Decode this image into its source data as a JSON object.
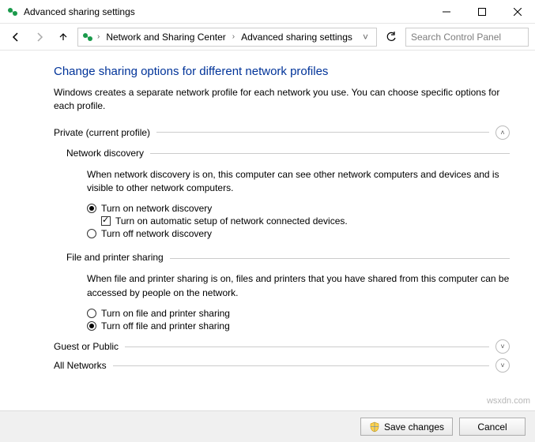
{
  "window": {
    "title": "Advanced sharing settings"
  },
  "breadcrumb": {
    "item1": "Network and Sharing Center",
    "item2": "Advanced sharing settings",
    "dropdown_glyph": "˅"
  },
  "search": {
    "placeholder": "Search Control Panel"
  },
  "page": {
    "heading": "Change sharing options for different network profiles",
    "description": "Windows creates a separate network profile for each network you use. You can choose specific options for each profile.",
    "private": {
      "label": "Private (current profile)",
      "netdisc": {
        "title": "Network discovery",
        "body": "When network discovery is on, this computer can see other network computers and devices and is visible to other network computers.",
        "opt_on": "Turn on network discovery",
        "auto": "Turn on automatic setup of network connected devices.",
        "opt_off": "Turn off network discovery"
      },
      "fps": {
        "title": "File and printer sharing",
        "body": "When file and printer sharing is on, files and printers that you have shared from this computer can be accessed by people on the network.",
        "opt_on": "Turn on file and printer sharing",
        "opt_off": "Turn off file and printer sharing"
      }
    },
    "guest": {
      "label": "Guest or Public"
    },
    "all": {
      "label": "All Networks"
    }
  },
  "footer": {
    "save": "Save changes",
    "cancel": "Cancel"
  },
  "watermark": "wsxdn.com"
}
